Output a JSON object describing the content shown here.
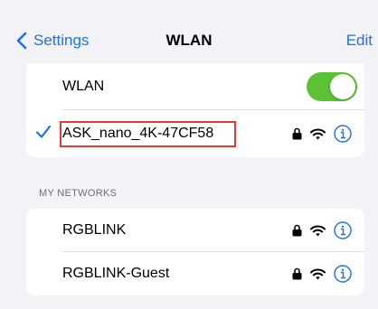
{
  "nav": {
    "back_label": "Settings",
    "title": "WLAN",
    "edit_label": "Edit"
  },
  "wlan_toggle": {
    "label": "WLAN",
    "on": true
  },
  "current_network": {
    "name": "ASK_nano_4K-47CF58",
    "connected": true,
    "secured": true,
    "highlighted": true
  },
  "my_networks": {
    "header": "MY NETWORKS",
    "items": [
      {
        "name": "RGBLINK",
        "secured": true
      },
      {
        "name": "RGBLINK-Guest",
        "secured": true
      }
    ]
  },
  "colors": {
    "accent": "#1a73e8",
    "toggle_on": "#5bc236",
    "highlight_border": "#e53935",
    "background": "#f2f2f7"
  }
}
